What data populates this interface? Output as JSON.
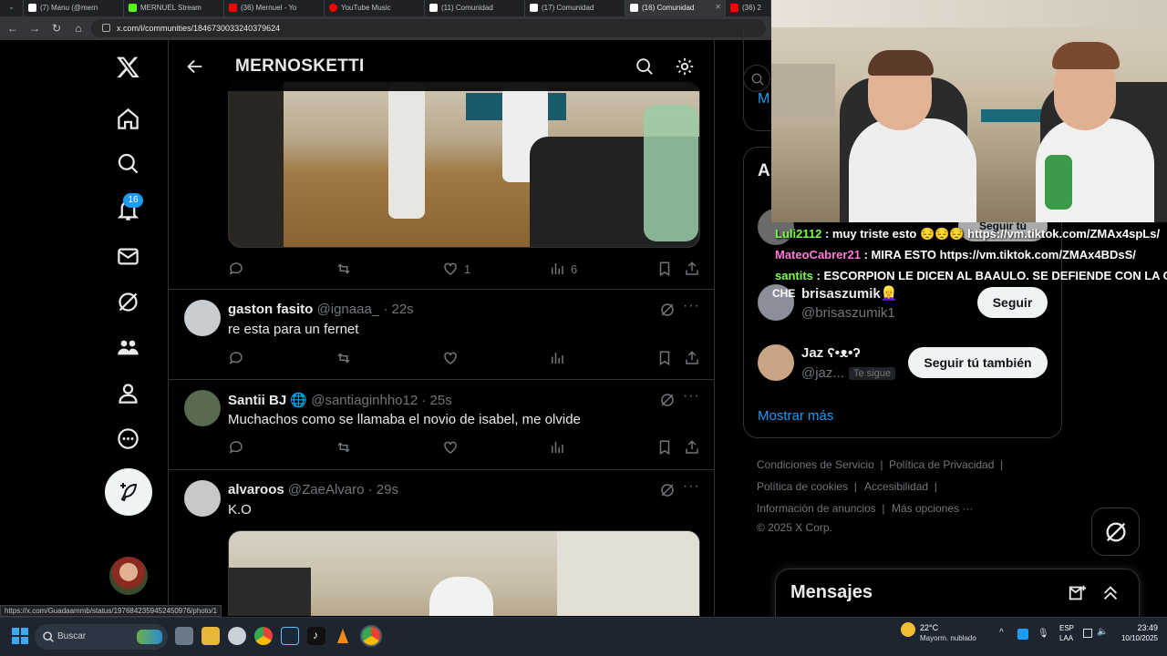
{
  "browser": {
    "tabs": [
      {
        "label": "(7) Manu (@mern",
        "color": "#ffffff"
      },
      {
        "label": "MERNUEL Stream",
        "color": "#53fc18"
      },
      {
        "label": "(36) Mernuel - Yo",
        "color": "#ff0000"
      },
      {
        "label": "YouTube Music",
        "color": "#ff0000"
      },
      {
        "label": "(11) Comunidad",
        "color": "#ffffff"
      },
      {
        "label": "(17) Comunidad",
        "color": "#ffffff"
      },
      {
        "label": "(16) Comunidad",
        "color": "#ffffff"
      },
      {
        "label": "(36) 2",
        "color": "#ff0000"
      }
    ],
    "url": "x.com/i/communities/1846730033240379624",
    "status_url": "https://x.com/Guadaammb/status/1976842359452450976/photo/1"
  },
  "nav": {
    "notification_count": "16",
    "icons": [
      "x-logo-icon",
      "home-icon",
      "search-icon",
      "notifications-icon",
      "messages-icon",
      "grok-icon",
      "communities-icon",
      "profile-icon",
      "more-icon",
      "post-icon"
    ]
  },
  "header": {
    "title": "MERNOSKETTI"
  },
  "tweets": [
    {
      "actions": {
        "reply": "",
        "repost": "",
        "like": "1",
        "views": "6"
      }
    },
    {
      "name": "gaston fasito",
      "handle": "@ignaaa_",
      "time": "· 22s",
      "text": "re esta para un fernet",
      "avatar_color": "#d0d4d8"
    },
    {
      "name": "Santii BJ",
      "handle": "@santiaginhho12",
      "time": "· 25s",
      "text": "Muchachos como se llamaba el novio de isabel, me olvide",
      "avatar_color": "#5a6a50",
      "verified_glyph": "🌐"
    },
    {
      "name": "alvaroos",
      "handle": "@ZaeAlvaro",
      "time": "· 29s",
      "text": "K.O",
      "avatar_color": "#c8c8c8"
    }
  ],
  "right": {
    "partial_link": "M",
    "section_initial": "A",
    "follows": [
      {
        "name": "brisaszumik👱‍♀️",
        "handle": "@brisaszumik1",
        "button": "Seguir",
        "avatar_color": "#8a8f9a"
      },
      {
        "name": "Jaz ʕ•ᴥ•ʔ",
        "handle": "@jaz...",
        "badge": "Te sigue",
        "button": "Seguir tú también",
        "avatar_color": "#c9a585"
      }
    ],
    "partial_button": "Seguir tú también",
    "show_more": "Mostrar más",
    "footer": {
      "links": [
        "Condiciones de Servicio",
        "Política de Privacidad",
        "Política de cookies",
        "Accesibilidad",
        "Información de anuncios",
        "Más opciones ···"
      ],
      "copyright": "© 2025 X Corp."
    }
  },
  "chat": {
    "messages": [
      {
        "user": "Luli2112",
        "text": ": muy triste esto 😔😔😔 https://vm.tiktok.com/ZMAx4spLs/",
        "color": "#7dff4a"
      },
      {
        "user": "MateoCabrer21",
        "text": ": MIRA ESTO https://vm.tiktok.com/ZMAx4BDsS/",
        "color": "#ff7ad9"
      },
      {
        "user": "santits",
        "text": ": ESCORPION LE DICEN AL BAAULO. SE DEFIENDE CON LA COLA",
        "color": "#7dff4a"
      }
    ],
    "overlay_label": "CHE"
  },
  "messages_drawer": {
    "title": "Mensajes"
  },
  "taskbar": {
    "search": "Buscar",
    "weather_temp": "22°C",
    "weather_desc": "Mayorm. nublado",
    "lang_top": "ESP",
    "lang_bottom": "LAA",
    "time": "23:49",
    "date": "10/10/2025"
  }
}
